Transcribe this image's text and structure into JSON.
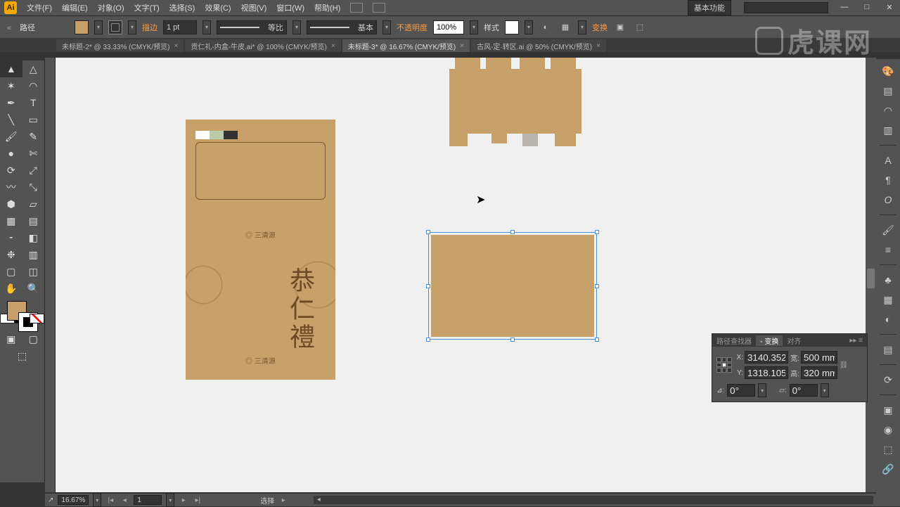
{
  "app": {
    "logo": "Ai"
  },
  "menu": {
    "file": "文件(F)",
    "edit": "编辑(E)",
    "object": "对象(O)",
    "type": "文字(T)",
    "select": "选择(S)",
    "effect": "效果(C)",
    "view": "视图(V)",
    "window": "窗口(W)",
    "help": "帮助(H)",
    "workspace": "基本功能"
  },
  "ctrl": {
    "sel_type": "路径",
    "stroke_lbl": "描边",
    "stroke_w": "1 pt",
    "dash1": "等比",
    "dash2": "基本",
    "opacity_lbl": "不透明度",
    "opacity_v": "100%",
    "style_lbl": "样式",
    "transform_lbl": "变换"
  },
  "tabs": [
    {
      "t": "未标题-2* @ 33.33% (CMYK/预览)",
      "active": false
    },
    {
      "t": "贡仁礼-内盒-牛皮.ai* @ 100% (CMYK/预览)",
      "active": false
    },
    {
      "t": "未标题-3* @ 16.67% (CMYK/预览)",
      "active": true
    },
    {
      "t": "古风-定·转区.ai @ 50% (CMYK/预览)",
      "active": false
    }
  ],
  "art": {
    "logotext1": "◎ 三清源",
    "bigtext": "恭仁禮",
    "logotext2": "◎ 三清源"
  },
  "tpanel": {
    "tab1": "路径查找器",
    "tab2": "变换",
    "tab3": "对齐",
    "x_k": "X:",
    "x_v": "3140.352",
    "y_k": "Y:",
    "y_v": "1318.105",
    "w_k": "宽:",
    "w_v": "500 mm",
    "h_k": "高:",
    "h_v": "320 mm",
    "ang": "0°",
    "shear": "0°"
  },
  "status": {
    "zoom": "16.67%",
    "artboard": "1",
    "tool": "选择"
  },
  "watermark": "虎课网"
}
